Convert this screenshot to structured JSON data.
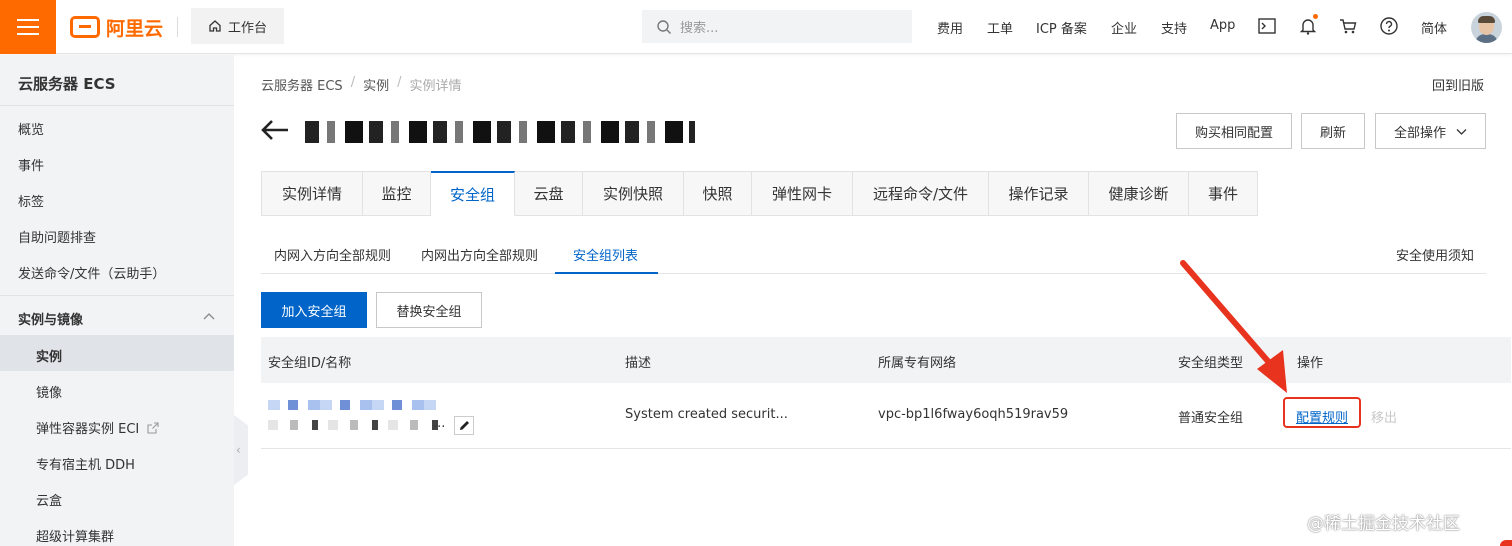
{
  "topbar": {
    "logo": "阿里云",
    "workbench": "工作台",
    "search_placeholder": "搜索...",
    "nav": [
      "费用",
      "工单",
      "ICP 备案",
      "企业",
      "支持",
      "App"
    ],
    "lang": "简体"
  },
  "sidebar": {
    "title": "云服务器 ECS",
    "items": [
      "概览",
      "事件",
      "标签",
      "自助问题排查",
      "发送命令/文件（云助手）"
    ],
    "group": "实例与镜像",
    "sub_items": [
      "实例",
      "镜像",
      "弹性容器实例 ECI",
      "专有宿主机 DDH",
      "云盒",
      "超级计算集群"
    ]
  },
  "breadcrumb": [
    "云服务器 ECS",
    "实例",
    "实例详情"
  ],
  "back_old": "回到旧版",
  "buttons": {
    "buy_same": "购买相同配置",
    "refresh": "刷新",
    "all_ops": "全部操作",
    "join_sg": "加入安全组",
    "replace_sg": "替换安全组"
  },
  "tabs": [
    "实例详情",
    "监控",
    "安全组",
    "云盘",
    "实例快照",
    "快照",
    "弹性网卡",
    "远程命令/文件",
    "操作记录",
    "健康诊断",
    "事件"
  ],
  "subtabs": [
    "内网入方向全部规则",
    "内网出方向全部规则",
    "安全组列表"
  ],
  "notice": "安全使用须知",
  "table": {
    "headers": [
      "安全组ID/名称",
      "描述",
      "所属专有网络",
      "安全组类型",
      "操作"
    ],
    "row": {
      "desc": "System created securit...",
      "vpc": "vpc-bp1l6fway6oqh519rav59",
      "type": "普通安全组",
      "ellipsis": "...",
      "action_config": "配置规则",
      "action_remove": "移出"
    }
  },
  "watermark": "@稀土掘金技术社区",
  "colors": {
    "brand": "#ff6a00",
    "primary": "#0064c8",
    "annotation": "#e8341f"
  }
}
